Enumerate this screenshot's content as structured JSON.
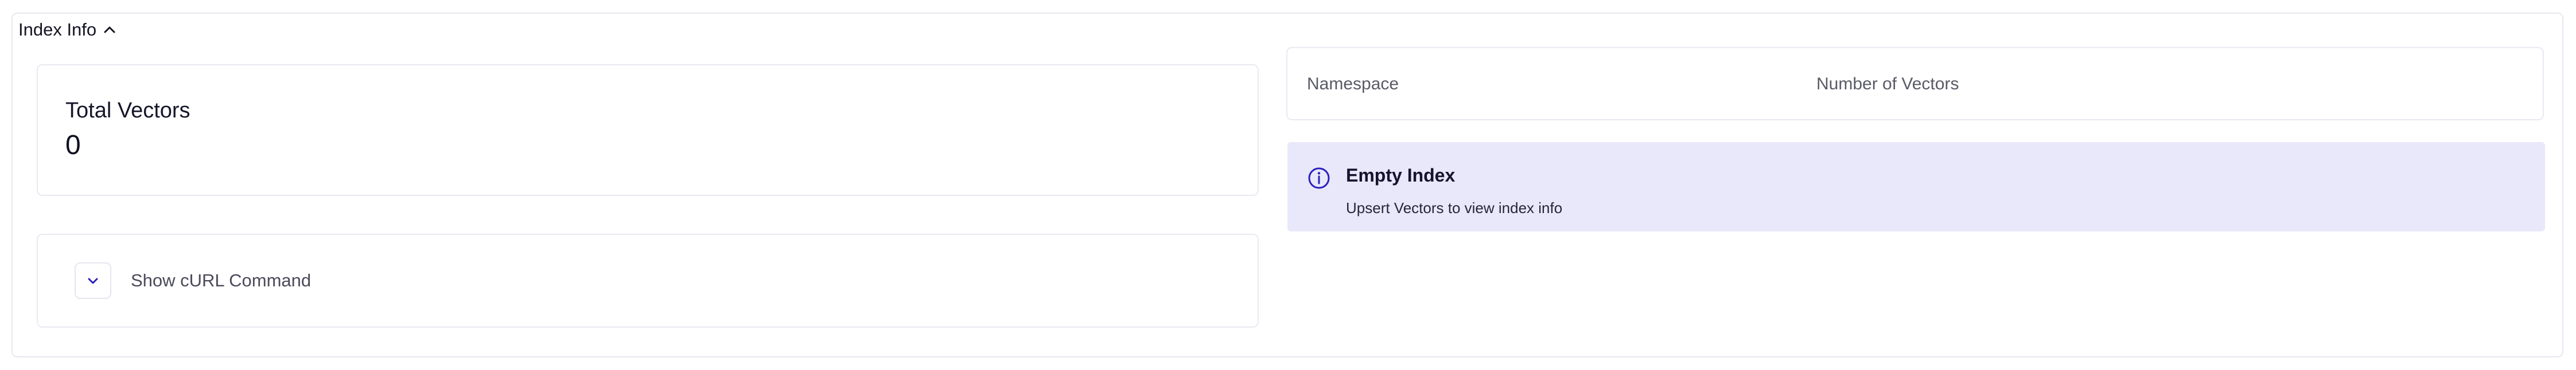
{
  "panel": {
    "title": "Index Info",
    "toggle_icon": "chevron-up-icon"
  },
  "total_vectors": {
    "label": "Total Vectors",
    "value": "0"
  },
  "curl": {
    "toggle_icon": "chevron-down-icon",
    "label": "Show cURL Command"
  },
  "namespace_table": {
    "columns": [
      "Namespace",
      "Number of Vectors"
    ]
  },
  "alert": {
    "icon": "info-icon",
    "title": "Empty Index",
    "message": "Upsert Vectors to view index info"
  },
  "colors": {
    "accent": "#2b1fbf",
    "alert_background": "#e9e8fa",
    "border": "#e7e8ef"
  }
}
